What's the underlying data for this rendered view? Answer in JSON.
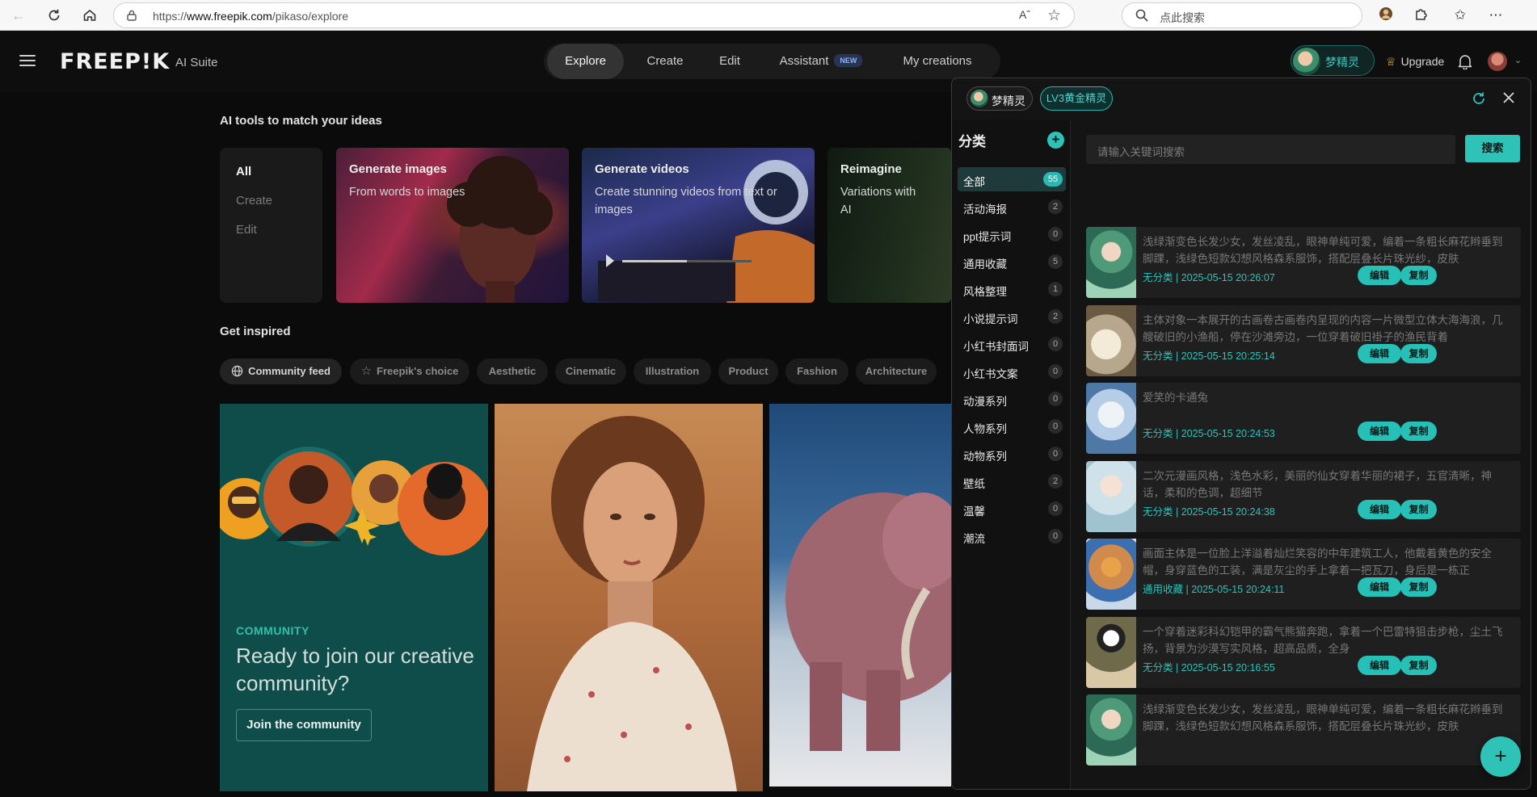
{
  "browser": {
    "url_prefix": "https://",
    "url_domain": "www.freepik.com",
    "url_path": "/pikaso/explore",
    "reader_label": "Aˆ",
    "search_placeholder": "点此搜索"
  },
  "header": {
    "logo": "FREEP!K",
    "logo_sub": "AI Suite",
    "nav": [
      {
        "label": "Explore",
        "active": true
      },
      {
        "label": "Create"
      },
      {
        "label": "Edit"
      },
      {
        "label": "Assistant",
        "badge": "NEW"
      },
      {
        "label": "My creations"
      }
    ],
    "user_name": "梦精灵",
    "upgrade": "Upgrade"
  },
  "main": {
    "tools_title": "AI tools to match your ideas",
    "filters": [
      "All",
      "Create",
      "Edit"
    ],
    "tools": [
      {
        "title": "Generate images",
        "sub": "From words to images"
      },
      {
        "title": "Generate videos",
        "sub": "Create stunning videos from text or images"
      },
      {
        "title": "Reimagine",
        "sub": "Variations with AI"
      }
    ],
    "inspired_title": "Get inspired",
    "chips": [
      "Community feed",
      "Freepik's choice",
      "Aesthetic",
      "Cinematic",
      "Illustration",
      "Product",
      "Fashion",
      "Architecture"
    ],
    "community": {
      "label": "COMMUNITY",
      "heading": "Ready to join our creative community?",
      "button": "Join the community"
    }
  },
  "panel": {
    "user": "梦精灵",
    "level": "LV3黄金精灵",
    "sidebar_title": "分类",
    "categories": [
      {
        "name": "全部",
        "count": "55",
        "active": true
      },
      {
        "name": "活动海报",
        "count": "2"
      },
      {
        "name": "ppt提示词",
        "count": "0"
      },
      {
        "name": "通用收藏",
        "count": "5"
      },
      {
        "name": "风格整理",
        "count": "1"
      },
      {
        "name": "小说提示词",
        "count": "2"
      },
      {
        "name": "小红书封面词",
        "count": "0"
      },
      {
        "name": "小红书文案",
        "count": "0"
      },
      {
        "name": "动漫系列",
        "count": "0"
      },
      {
        "name": "人物系列",
        "count": "0"
      },
      {
        "name": "动物系列",
        "count": "0"
      },
      {
        "name": "壁纸",
        "count": "2"
      },
      {
        "name": "温馨",
        "count": "0"
      },
      {
        "name": "潮流",
        "count": "0"
      }
    ],
    "search_placeholder": "请输入关键词搜索",
    "search_button": "搜索",
    "edit_label": "编辑",
    "copy_label": "复制",
    "items": [
      {
        "text": "浅绿渐变色长发少女，发丝凌乱，眼神单纯可爱，编着一条粗长麻花辫垂到脚踝，浅绿色短款幻想风格森系服饰，搭配层叠长片珠光纱，皮肤",
        "meta": "无分类 | 2025-05-15 20:26:07"
      },
      {
        "text": "主体对象一本展开的古画卷古画卷内呈现的内容一片微型立体大海海浪，几艘破旧的小渔船，停在沙滩旁边，一位穿着破旧褂子的渔民背着",
        "meta": "无分类 | 2025-05-15 20:25:14"
      },
      {
        "text": "爱笑的卡通兔",
        "meta": "无分类 | 2025-05-15 20:24:53"
      },
      {
        "text": "二次元漫画风格，浅色水彩，美丽的仙女穿着华丽的裙子，五官清晰，神话，柔和的色调，超细节",
        "meta": "无分类 | 2025-05-15 20:24:38"
      },
      {
        "text": "画面主体是一位脸上洋溢着灿烂笑容的中年建筑工人，他戴着黄色的安全帽，身穿蓝色的工装，满是灰尘的手上拿着一把瓦刀，身后是一栋正",
        "meta": "通用收藏 | 2025-05-15 20:24:11"
      },
      {
        "text": "一个穿着迷彩科幻铠甲的霸气熊猫奔跑，拿着一个巴雷特狙击步枪，尘土飞扬，背景为沙漠写实风格，超高品质，全身",
        "meta": "无分类 | 2025-05-15 20:16:55"
      },
      {
        "text": "浅绿渐变色长发少女，发丝凌乱，眼神单纯可爱，编着一条粗长麻花辫垂到脚踝，浅绿色短款幻想风格森系服饰，搭配层叠长片珠光纱，皮肤",
        "meta": ""
      }
    ]
  }
}
